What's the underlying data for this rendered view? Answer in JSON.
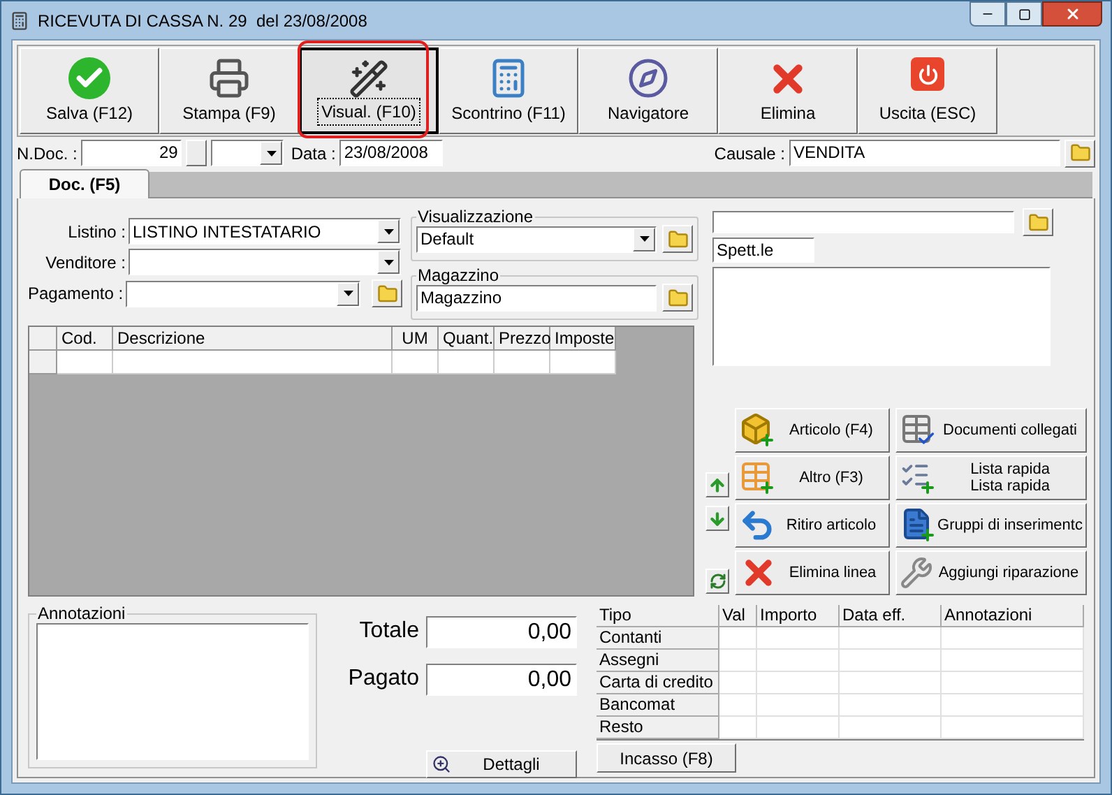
{
  "window": {
    "title": "RICEVUTA DI CASSA N. 29  del 23/08/2008"
  },
  "toolbar": [
    {
      "label": "Salva (F12)",
      "kind": "save",
      "focused": false,
      "highlighted": false
    },
    {
      "label": "Stampa (F9)",
      "kind": "print",
      "focused": false,
      "highlighted": false
    },
    {
      "label": "Visual. (F10)",
      "kind": "preview",
      "focused": true,
      "highlighted": true
    },
    {
      "label": "Scontrino (F11)",
      "kind": "register",
      "focused": false,
      "highlighted": false
    },
    {
      "label": "Navigatore",
      "kind": "navigator",
      "focused": false,
      "highlighted": false
    },
    {
      "label": "Elimina",
      "kind": "delete",
      "focused": false,
      "highlighted": false
    },
    {
      "label": "Uscita (ESC)",
      "kind": "exit",
      "focused": false,
      "highlighted": false
    }
  ],
  "header": {
    "ndoc_label": "N.Doc. :",
    "ndoc_value": "29",
    "data_label": "Data :",
    "data_value": "23/08/2008",
    "causale_label": "Causale :",
    "causale_value": "VENDITA"
  },
  "tabs": [
    {
      "label": "Doc. (F5)",
      "selected": true
    }
  ],
  "fields": [
    {
      "label": "Listino :",
      "value": "LISTINO INTESTATARIO",
      "folder": false
    },
    {
      "label": "Venditore :",
      "folder": false
    },
    {
      "label": "Pagamento :",
      "folder": true
    }
  ],
  "groups": [
    {
      "title": "Visualizzazione",
      "value": "Default",
      "kind": "combo"
    },
    {
      "title": "Magazzino",
      "value": "Magazzino",
      "kind": "text"
    }
  ],
  "customer": {
    "salutation": "Spett.le"
  },
  "lines_table": {
    "columns": [
      "Cod.",
      "Descrizione",
      "UM",
      "Quant.",
      "Prezzo",
      "Imposte"
    ]
  },
  "actions": [
    {
      "label": "Articolo (F4)",
      "kind": "article"
    },
    {
      "label": "Documenti collegati",
      "kind": "linked"
    },
    {
      "label": "Altro (F3)",
      "kind": "other"
    },
    {
      "label": "Lista rapida",
      "sublabel": "Lista rapida",
      "kind": "quicklist"
    },
    {
      "label": "Ritiro articolo",
      "kind": "return"
    },
    {
      "label": "Gruppi di inserimentc",
      "kind": "groups"
    },
    {
      "label": "Elimina linea",
      "kind": "delete"
    },
    {
      "label": "Aggiungi riparazione",
      "kind": "repair"
    }
  ],
  "annotations": {
    "title": "Annotazioni"
  },
  "totals": [
    {
      "label": "Totale",
      "value": "0,00"
    },
    {
      "label": "Pagato",
      "value": "0,00"
    }
  ],
  "details_button": {
    "label": "Dettagli"
  },
  "payments": {
    "columns": [
      "Tipo",
      "Val",
      "Importo",
      "Data eff.",
      "Annotazioni"
    ],
    "rows": [
      "Contanti",
      "Assegni",
      "Carta di credito",
      "Bancomat",
      "Resto"
    ]
  },
  "incasso_button": {
    "label": "Incasso (F8)"
  }
}
